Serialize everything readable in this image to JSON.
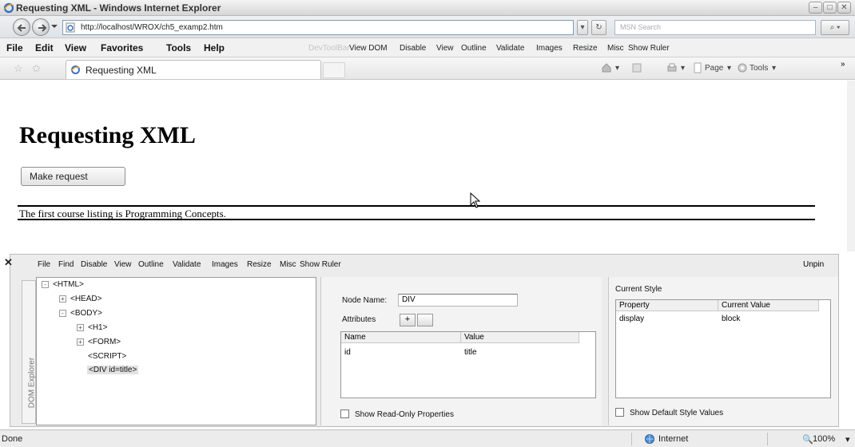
{
  "window": {
    "title": "Requesting XML - Windows Internet Explorer"
  },
  "address_bar": {
    "url": "http://localhost/WROX/ch5_examp2.htm",
    "search_placeholder": "MSN Search"
  },
  "menu": {
    "items": [
      "File",
      "Edit",
      "View",
      "Favorites",
      "Tools",
      "Help"
    ]
  },
  "dev_toolbar": {
    "label": "DevToolBar",
    "items": [
      "View DOM",
      "Disable",
      "View",
      "Outline",
      "Validate",
      "Images",
      "Resize",
      "Misc",
      "Show Ruler"
    ]
  },
  "tab": {
    "label": "Requesting XML"
  },
  "command_bar": {
    "page_label": "Page",
    "tools_label": "Tools"
  },
  "page": {
    "heading": "Requesting XML",
    "button_label": "Make request",
    "div_text": "The first course listing is Programming Concepts."
  },
  "dom_explorer": {
    "title": "DOM Explorer",
    "menu": [
      "File",
      "Find",
      "Disable",
      "View",
      "Outline",
      "Validate",
      "Images",
      "Resize",
      "Misc",
      "Show Ruler"
    ],
    "unpin": "Unpin",
    "tree": [
      {
        "label": "<HTML>",
        "expander": "-"
      },
      {
        "label": "<HEAD>",
        "expander": "+"
      },
      {
        "label": "<BODY>",
        "expander": "-"
      },
      {
        "label": "<H1>",
        "expander": "+"
      },
      {
        "label": "<FORM>",
        "expander": "+"
      },
      {
        "label": "<SCRIPT>",
        "expander": ""
      },
      {
        "label": "<DIV id=title>",
        "expander": ""
      }
    ],
    "node_name_label": "Node Name:",
    "node_name_value": "DIV",
    "attributes_label": "Attributes",
    "add_symbol": "+",
    "attr_headers": [
      "Name",
      "Value"
    ],
    "attr_rows": [
      {
        "name": "id",
        "value": "title"
      }
    ],
    "show_readonly": "Show Read-Only Properties",
    "current_style_label": "Current Style",
    "style_headers": [
      "Property",
      "Current Value"
    ],
    "style_rows": [
      {
        "property": "display",
        "value": "block"
      }
    ],
    "show_default": "Show Default Style Values"
  },
  "status": {
    "text": "Done",
    "zone": "Internet",
    "zoom": "100%"
  },
  "colors": {
    "ie_blue": "#2d6bc4",
    "window_chrome": "#e4e4e4"
  }
}
